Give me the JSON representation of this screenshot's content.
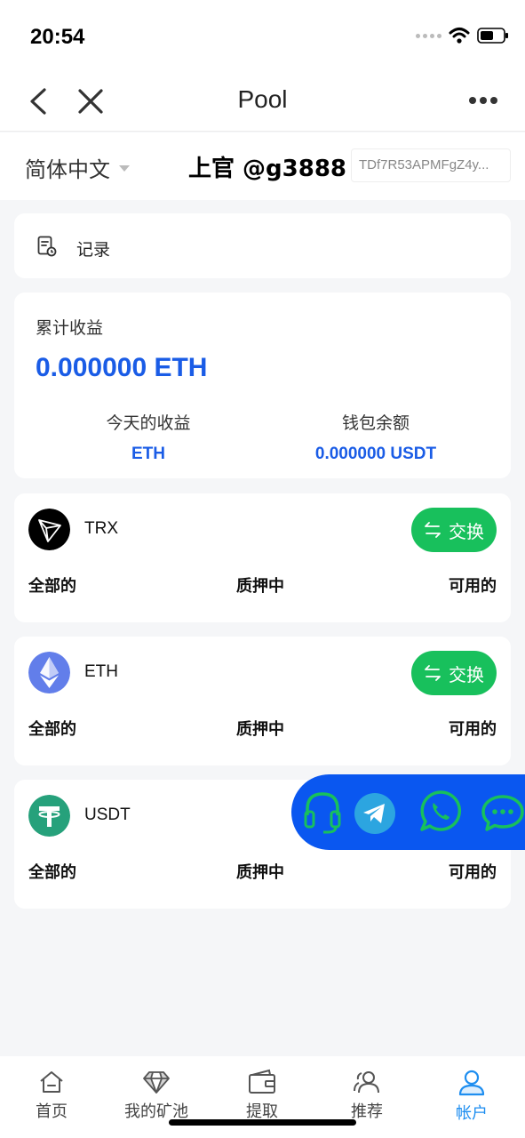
{
  "status_bar": {
    "time": "20:54"
  },
  "nav": {
    "title": "Pool"
  },
  "header": {
    "language": "简体中文",
    "username": "上官 @g3888",
    "address": "TDf7R53APMFgZ4y..."
  },
  "records": {
    "label": "记录"
  },
  "earnings": {
    "label": "累计收益",
    "total": "0.000000 ETH",
    "today_label": "今天的收益",
    "today_value": "ETH",
    "wallet_label": "钱包余额",
    "wallet_value": "0.000000 USDT"
  },
  "coins": [
    {
      "name": "TRX",
      "swap_label": "交换",
      "cols": [
        "全部的",
        "质押中",
        "可用的"
      ]
    },
    {
      "name": "ETH",
      "swap_label": "交换",
      "cols": [
        "全部的",
        "质押中",
        "可用的"
      ]
    },
    {
      "name": "USDT",
      "cols": [
        "全部的",
        "质押中",
        "可用的"
      ]
    }
  ],
  "float_bar": {
    "icons": [
      "headset-icon",
      "telegram-icon",
      "whatsapp-icon",
      "wechat-icon"
    ]
  },
  "tabbar": {
    "items": [
      {
        "label": "首页",
        "icon": "home-icon"
      },
      {
        "label": "我的矿池",
        "icon": "diamond-icon"
      },
      {
        "label": "提取",
        "icon": "wallet-icon"
      },
      {
        "label": "推荐",
        "icon": "users-icon"
      },
      {
        "label": "帐户",
        "icon": "user-icon"
      }
    ],
    "active": "帐户"
  },
  "colors": {
    "accent": "#1a5ce6",
    "swap_green": "#18c05c",
    "float_blue": "#0a57f0",
    "tab_active": "#1e8ef0"
  }
}
